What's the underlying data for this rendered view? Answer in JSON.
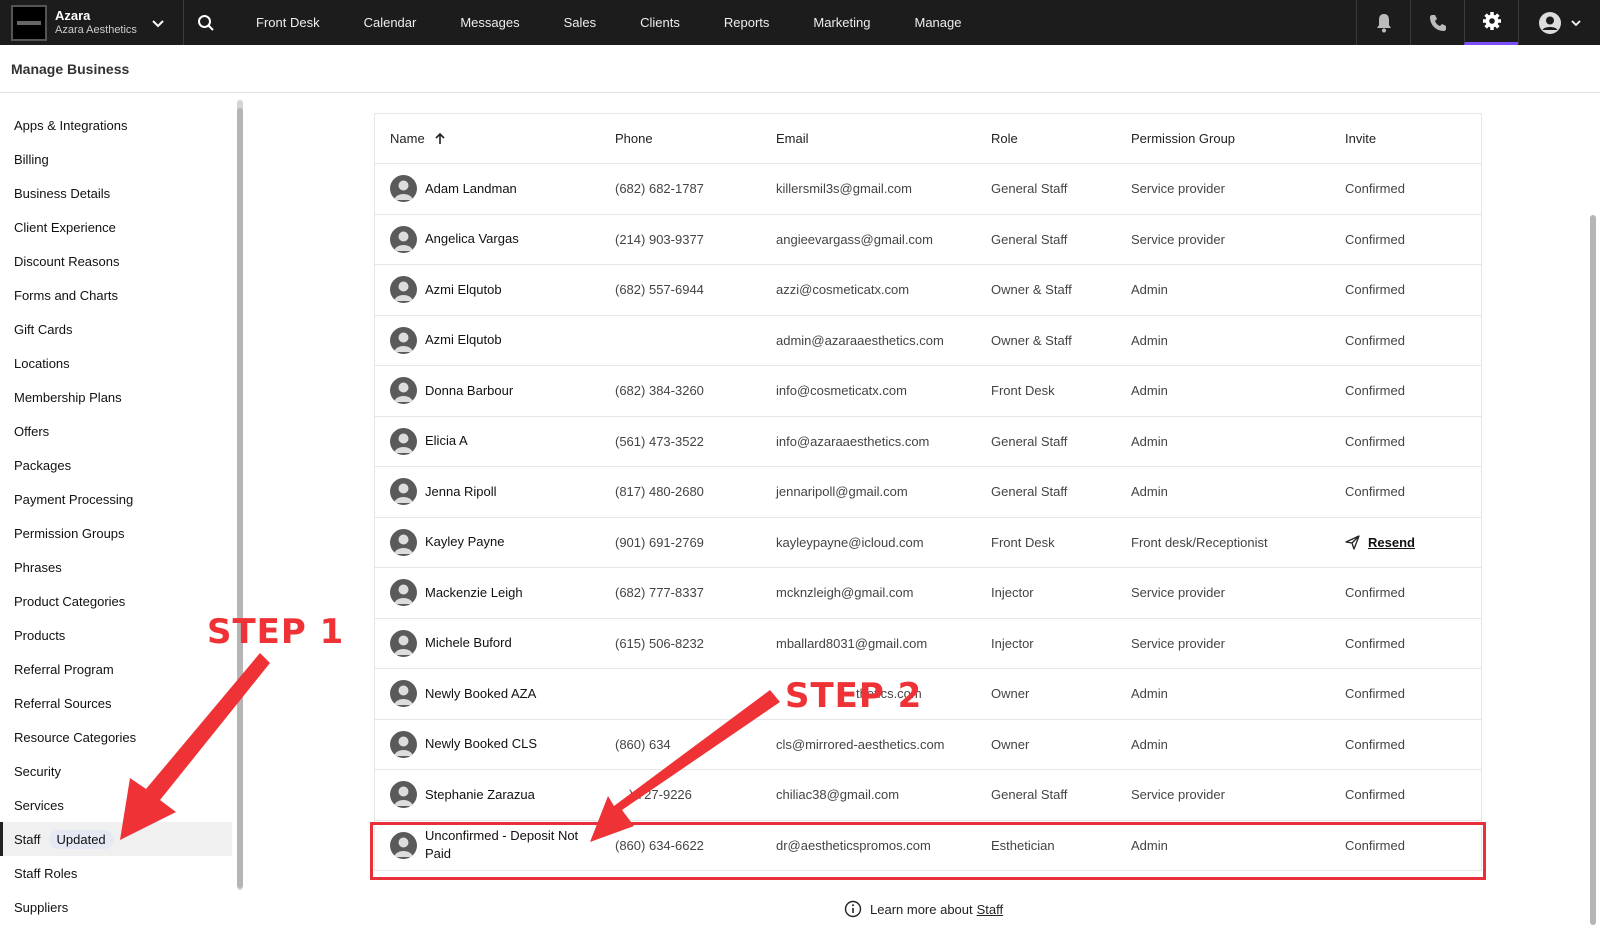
{
  "topbar": {
    "brand_name": "Azara",
    "brand_sub": "Azara Aesthetics",
    "nav": [
      "Front Desk",
      "Calendar",
      "Messages",
      "Sales",
      "Clients",
      "Reports",
      "Marketing",
      "Manage"
    ]
  },
  "page_title": "Manage Business",
  "sidebar": {
    "items": [
      "Apps & Integrations",
      "Billing",
      "Business Details",
      "Client Experience",
      "Discount Reasons",
      "Forms and Charts",
      "Gift Cards",
      "Locations",
      "Membership Plans",
      "Offers",
      "Packages",
      "Payment Processing",
      "Permission Groups",
      "Phrases",
      "Product Categories",
      "Products",
      "Referral Program",
      "Referral Sources",
      "Resource Categories",
      "Security",
      "Services"
    ],
    "active_label": "Staff",
    "active_badge": "Updated",
    "after": [
      "Staff Roles",
      "Suppliers"
    ]
  },
  "table": {
    "headers": {
      "name": "Name",
      "phone": "Phone",
      "email": "Email",
      "role": "Role",
      "permission": "Permission Group",
      "invite": "Invite"
    },
    "rows": [
      {
        "name": "Adam Landman",
        "phone": "(682) 682-1787",
        "email": "killersmil3s@gmail.com",
        "role": "General Staff",
        "permission": "Service provider",
        "invite": "Confirmed"
      },
      {
        "name": "Angelica Vargas",
        "phone": "(214) 903-9377",
        "email": "angieevargass@gmail.com",
        "role": "General Staff",
        "permission": "Service provider",
        "invite": "Confirmed"
      },
      {
        "name": "Azmi Elqutob",
        "phone": "(682) 557-6944",
        "email": "azzi@cosmeticatx.com",
        "role": "Owner & Staff",
        "permission": "Admin",
        "invite": "Confirmed"
      },
      {
        "name": "Azmi Elqutob",
        "phone": "",
        "email": "admin@azaraaesthetics.com",
        "role": "Owner & Staff",
        "permission": "Admin",
        "invite": "Confirmed"
      },
      {
        "name": "Donna Barbour",
        "phone": "(682) 384-3260",
        "email": "info@cosmeticatx.com",
        "role": "Front Desk",
        "permission": "Admin",
        "invite": "Confirmed"
      },
      {
        "name": "Elicia A",
        "phone": "(561) 473-3522",
        "email": "info@azaraaesthetics.com",
        "role": "General Staff",
        "permission": "Admin",
        "invite": "Confirmed"
      },
      {
        "name": "Jenna Ripoll",
        "phone": "(817) 480-2680",
        "email": "jennaripoll@gmail.com",
        "role": "General Staff",
        "permission": "Admin",
        "invite": "Confirmed"
      },
      {
        "name": "Kayley Payne",
        "phone": "(901) 691-2769",
        "email": "kayleypayne@icloud.com",
        "role": "Front Desk",
        "permission": "Front desk/Receptionist",
        "invite": "Resend"
      },
      {
        "name": "Mackenzie Leigh",
        "phone": "(682) 777-8337",
        "email": "mcknzleigh@gmail.com",
        "role": "Injector",
        "permission": "Service provider",
        "invite": "Confirmed"
      },
      {
        "name": "Michele Buford",
        "phone": "(615) 506-8232",
        "email": "mballard8031@gmail.com",
        "role": "Injector",
        "permission": "Service provider",
        "invite": "Confirmed"
      },
      {
        "name": "Newly Booked AZA",
        "phone": "",
        "email": "thetics.com",
        "role": "Owner",
        "permission": "Admin",
        "invite": "Confirmed"
      },
      {
        "name": "Newly Booked CLS",
        "phone": "(860) 634",
        "email": "cls@mirrored-aesthetics.com",
        "role": "Owner",
        "permission": "Admin",
        "invite": "Confirmed"
      },
      {
        "name": "Stephanie Zarazua",
        "phone": ") 727-9226",
        "email": "chiliac38@gmail.com",
        "role": "General Staff",
        "permission": "Service provider",
        "invite": "Confirmed"
      },
      {
        "name": "Unconfirmed - Deposit Not Paid",
        "phone": "(860) 634-6622",
        "email": "dr@aestheticspromos.com",
        "role": "Esthetician",
        "permission": "Admin",
        "invite": "Confirmed"
      }
    ]
  },
  "learn_more": {
    "prefix": "Learn more about",
    "link": "Staff"
  },
  "annotations": {
    "step1": "STEP 1",
    "step2": "STEP 2",
    "color": "#ee3236"
  }
}
